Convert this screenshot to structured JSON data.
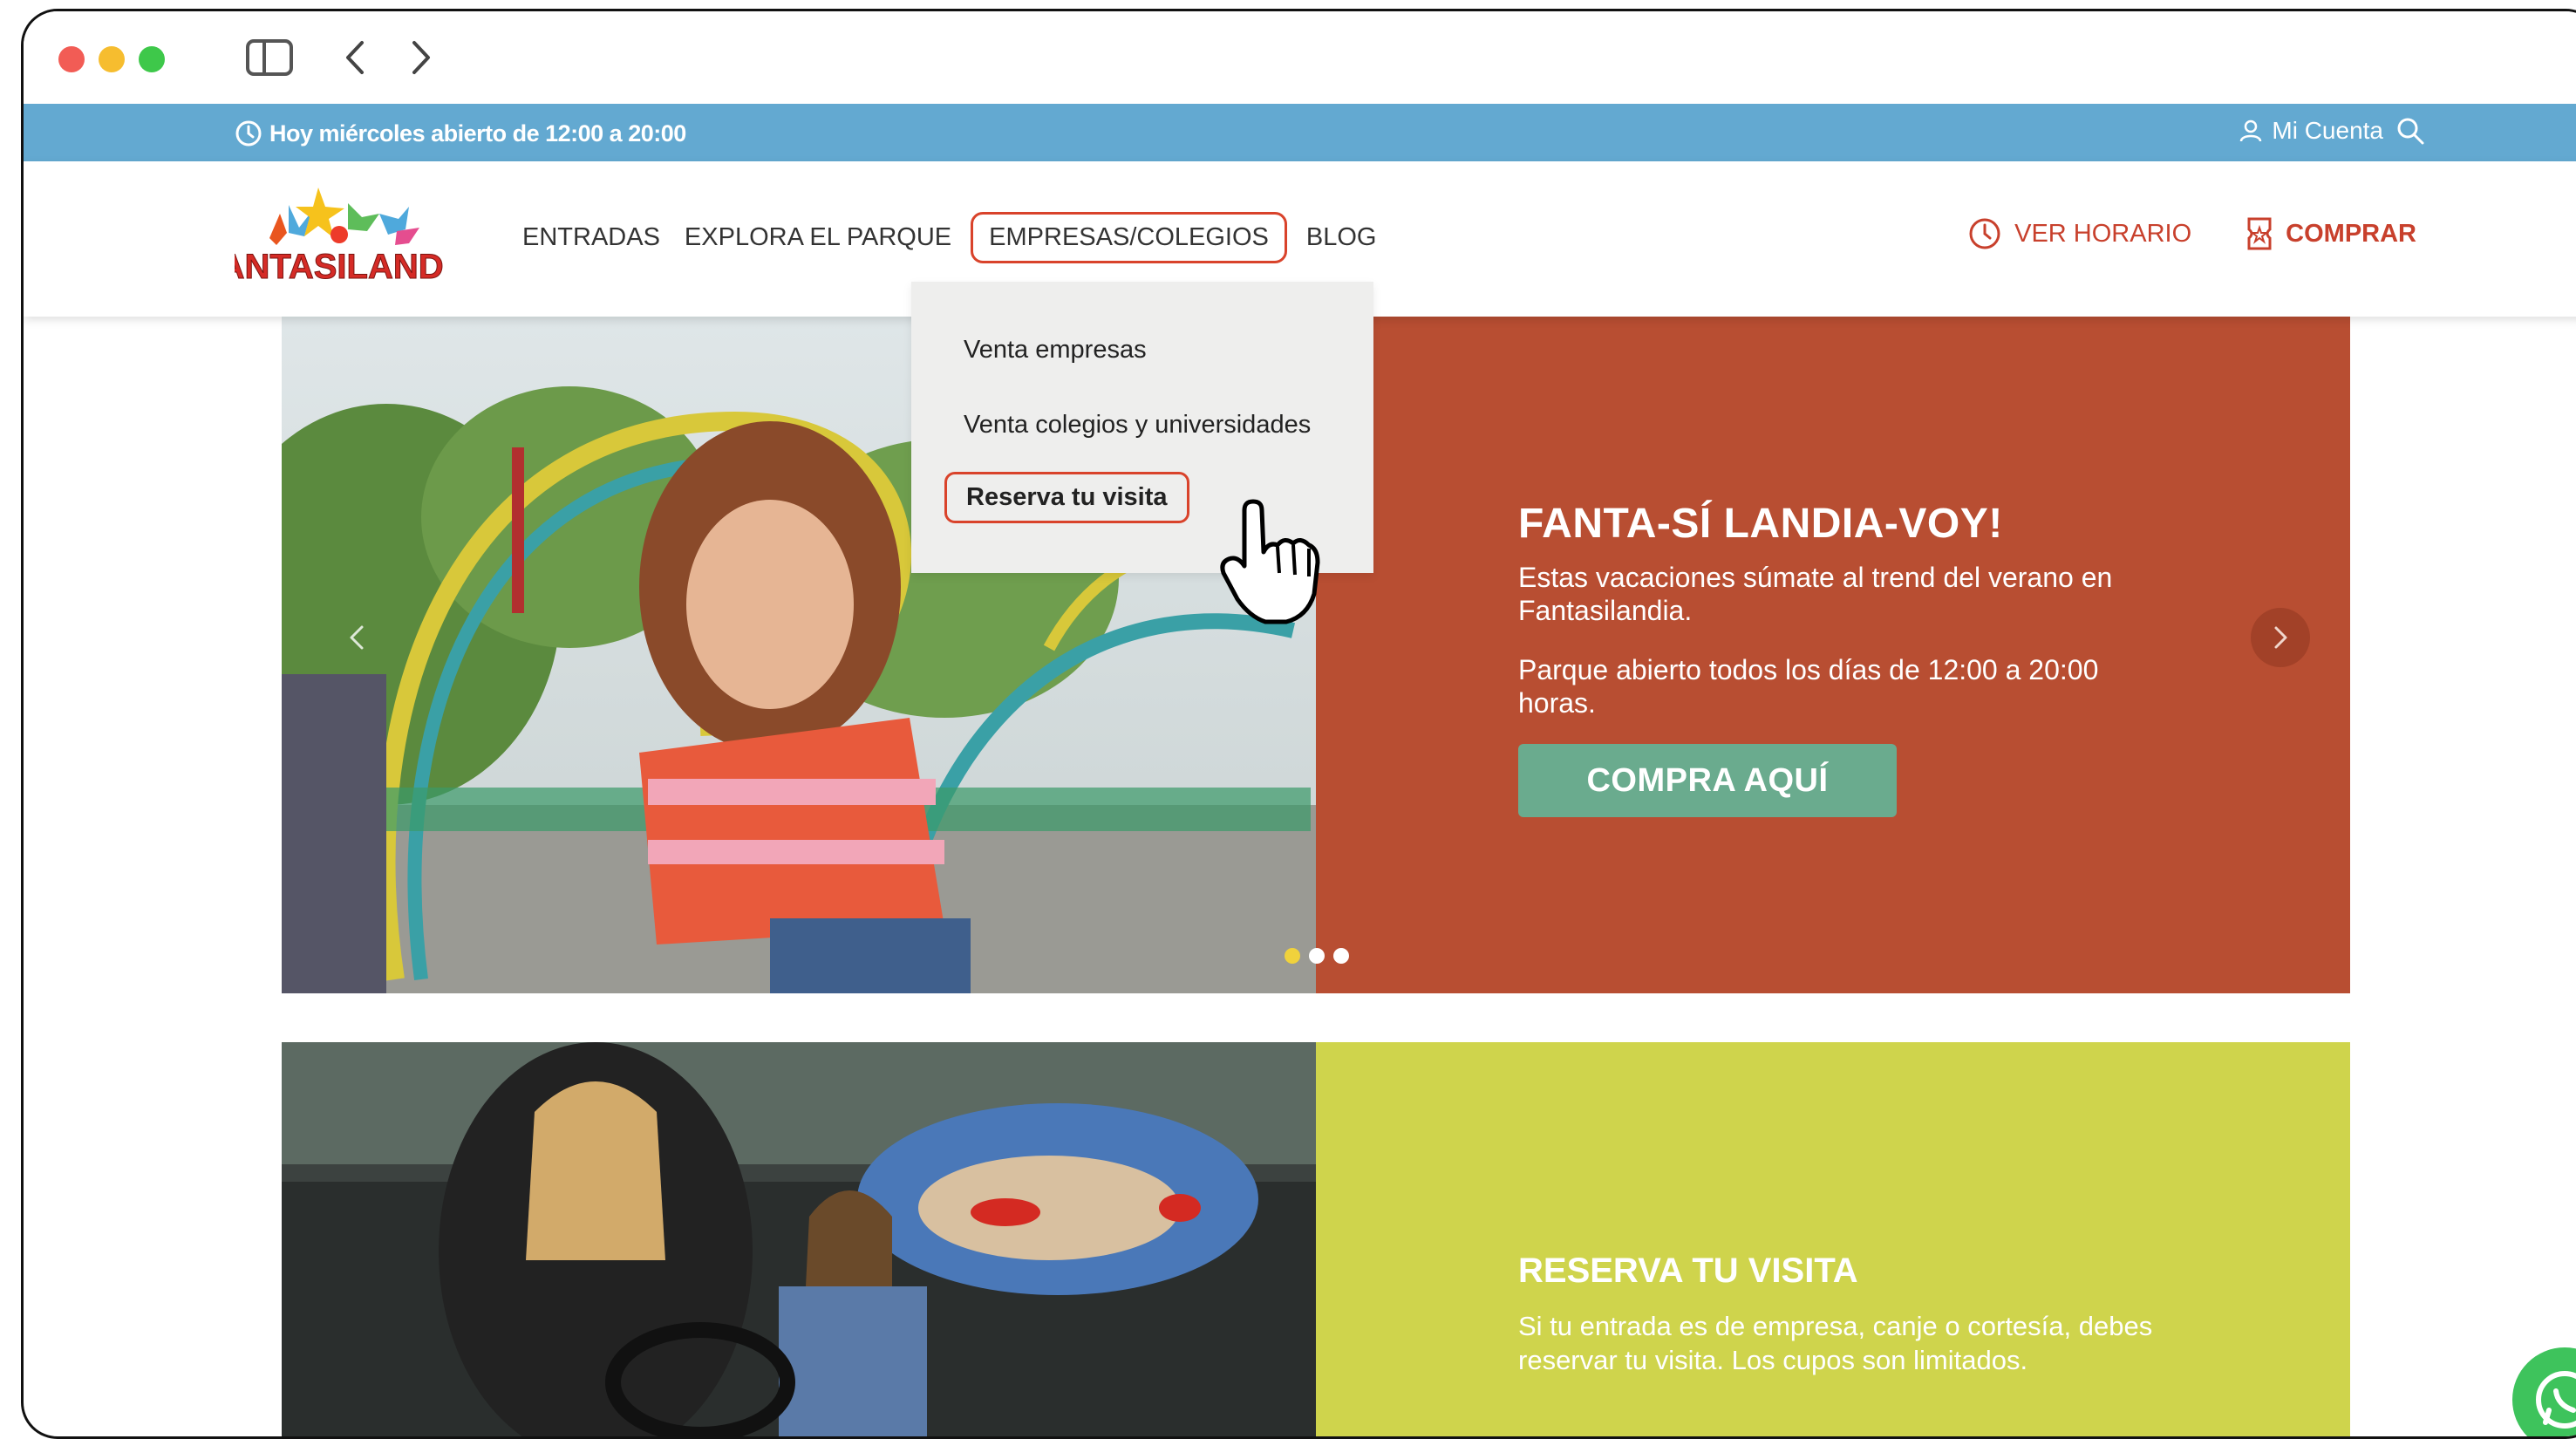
{
  "browser": {
    "icons": [
      "sidebar-icon",
      "back-chevron-icon",
      "forward-chevron-icon"
    ]
  },
  "infobar": {
    "hours_text": "Hoy miércoles abierto de 12:00 a 20:00",
    "account_label": "Mi Cuenta",
    "icons": [
      "clock-icon",
      "user-icon",
      "search-icon"
    ]
  },
  "nav": {
    "logo_text": "FANTASILANDIA",
    "items": [
      {
        "label": "ENTRADAS"
      },
      {
        "label": "EXPLORA EL PARQUE"
      },
      {
        "label": "EMPRESAS/COLEGIOS"
      },
      {
        "label": "BLOG"
      }
    ],
    "ver_horario": "VER HORARIO",
    "comprar": "COMPRAR"
  },
  "dropdown": {
    "items": [
      {
        "label": "Venta empresas"
      },
      {
        "label": "Venta colegios y universidades"
      },
      {
        "label": "Reserva tu visita"
      }
    ]
  },
  "hero": {
    "title": "FANTA-SÍ LANDIA-VOY!",
    "text1": "Estas vacaciones súmate al trend del verano en Fantasilandia.",
    "text2": "Parque abierto todos los días de 12:00 a 20:00 horas.",
    "cta": "COMPRA AQUÍ",
    "dots": 3,
    "active_dot": 0
  },
  "block2": {
    "title": "RESERVA TU VISITA",
    "text": "Si tu entrada es de empresa, canje o cortesía, debes reservar tu visita. Los cupos son limitados."
  },
  "colors": {
    "infobar": "#63a9d1",
    "accent": "#c8402c",
    "hero_panel": "#b84e32",
    "cta": "#6aab8e",
    "block2_panel": "#cfd44c",
    "whatsapp": "#3ec35c"
  }
}
